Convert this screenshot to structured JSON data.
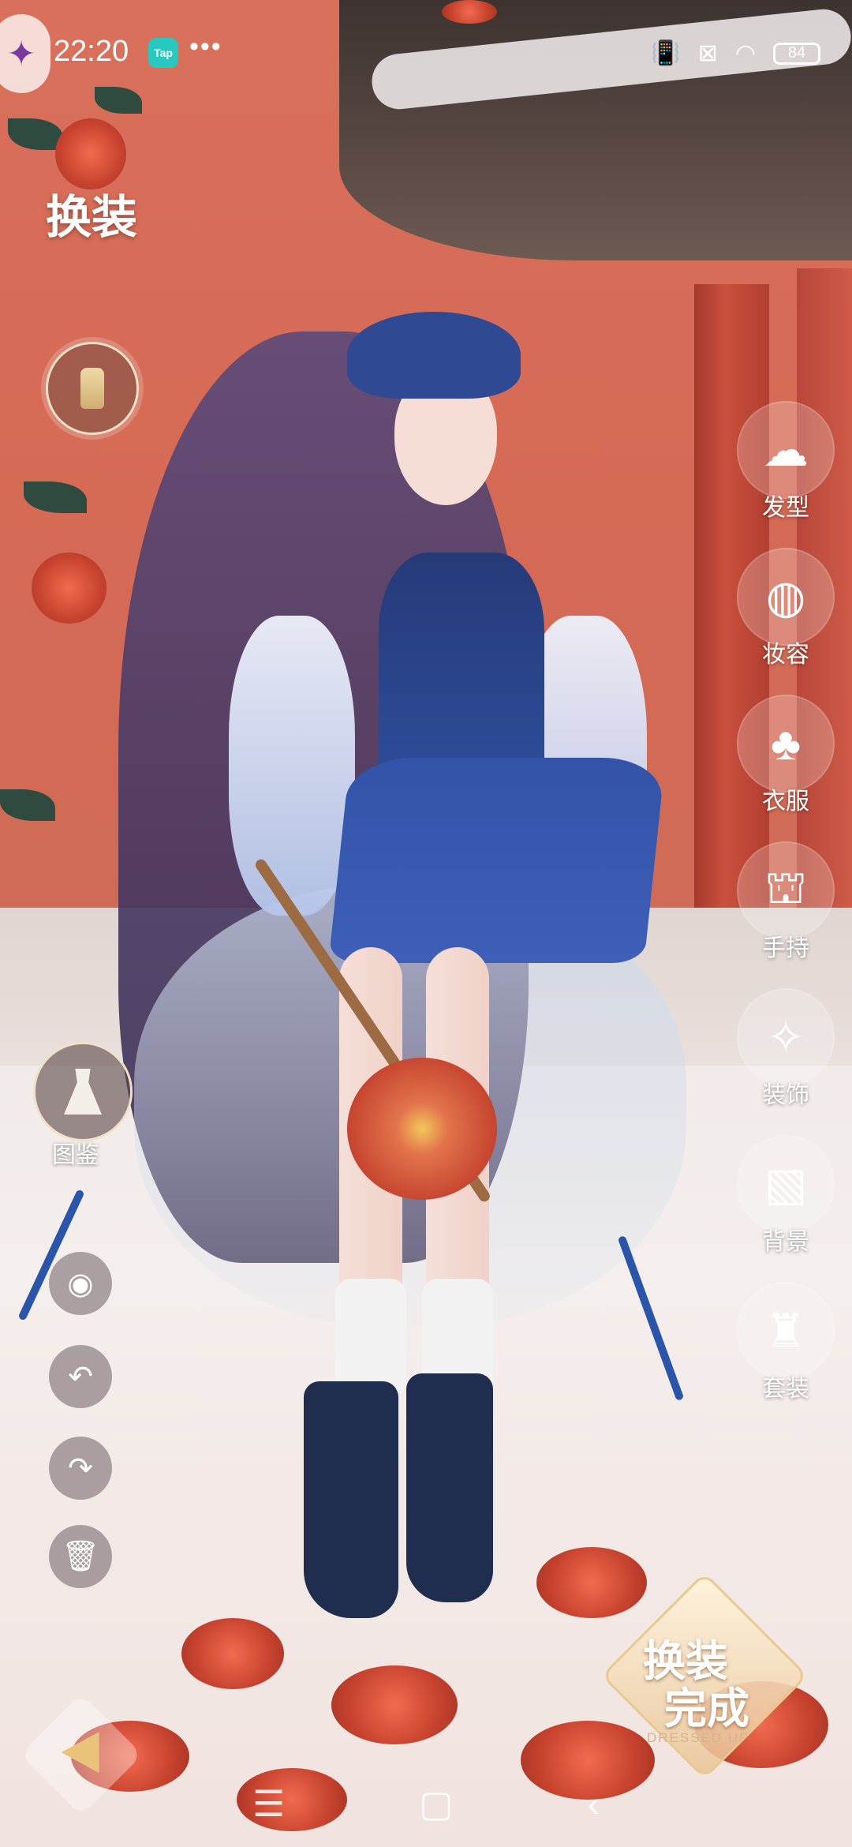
{
  "status_bar": {
    "time": "22:20",
    "tap_badge": "Tap",
    "more": "•••",
    "battery": "84"
  },
  "page": {
    "title": "换装"
  },
  "left_panel": {
    "catalog_label": "图鉴"
  },
  "side_menu": {
    "items": [
      {
        "label": "发型",
        "icon": "hairstyle-icon"
      },
      {
        "label": "妆容",
        "icon": "makeup-icon"
      },
      {
        "label": "衣服",
        "icon": "clothes-icon"
      },
      {
        "label": "手持",
        "icon": "handheld-icon"
      },
      {
        "label": "装饰",
        "icon": "decoration-icon"
      },
      {
        "label": "背景",
        "icon": "background-icon"
      },
      {
        "label": "套装",
        "icon": "outfit-set-icon"
      }
    ]
  },
  "done_button": {
    "line1": "换装",
    "line2": "完成",
    "subtitle": "DRESSED UP"
  },
  "colors": {
    "wall": "#d56a55",
    "pillar": "#b23f31",
    "dress": "#2f4f9e",
    "gold_accent": "#e8c98f"
  }
}
